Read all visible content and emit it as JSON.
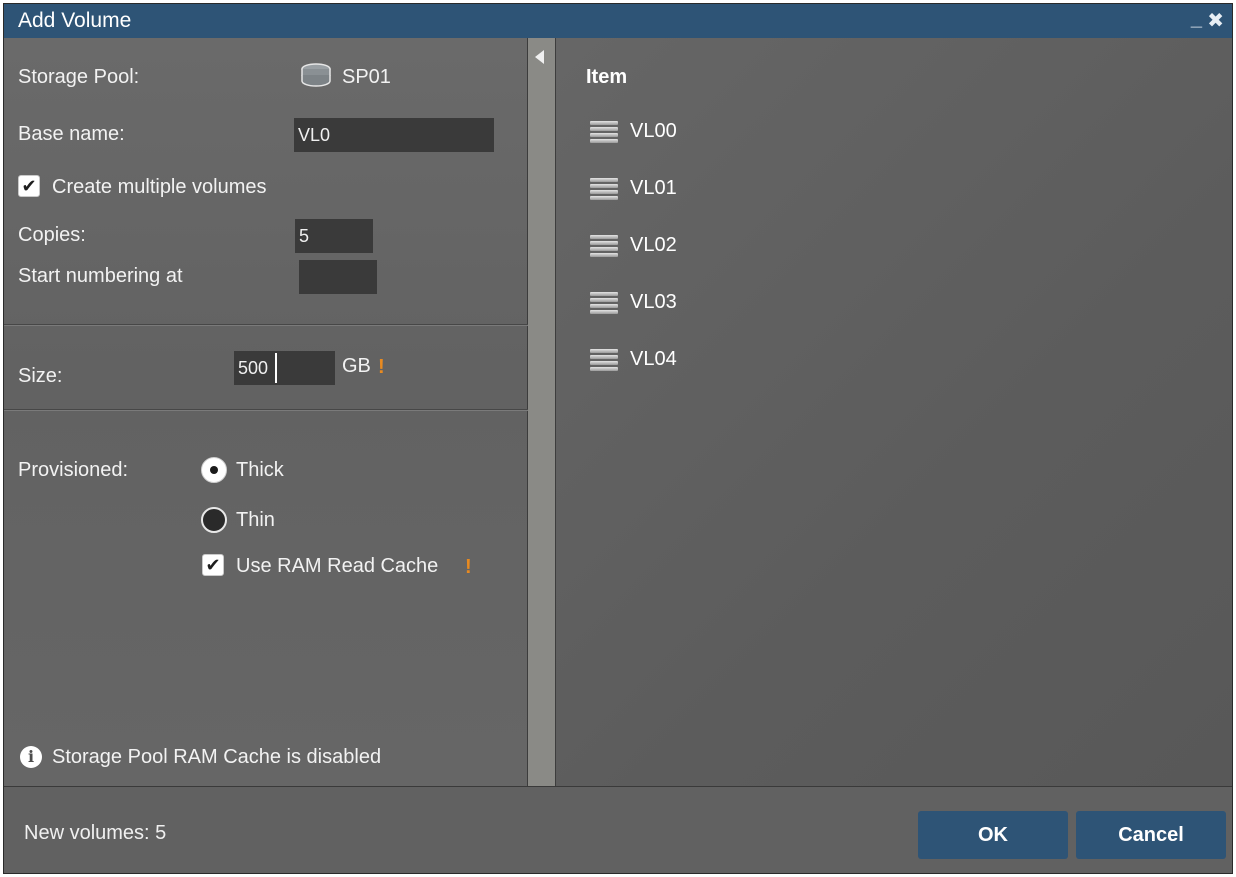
{
  "window": {
    "title": "Add Volume",
    "minimize_glyph": "_",
    "close_glyph": "✖"
  },
  "form": {
    "storage_pool_label": "Storage Pool:",
    "storage_pool_value": "SP01",
    "storage_pool_icon": "database-icon",
    "base_name_label": "Base name:",
    "base_name_value": "VL0",
    "create_multiple_label": "Create multiple volumes",
    "create_multiple_checked": true,
    "copies_label": "Copies:",
    "copies_value": "5",
    "start_numbering_label": "Start numbering at",
    "start_numbering_value": "",
    "size_label": "Size:",
    "size_value": "500",
    "size_unit": "GB",
    "warning_glyph": "!",
    "provisioned_label": "Provisioned:",
    "provision_options": [
      {
        "label": "Thick",
        "selected": true
      },
      {
        "label": "Thin",
        "selected": false
      }
    ],
    "ram_cache_label": "Use RAM Read Cache",
    "ram_cache_checked": true,
    "info_glyph": "i",
    "info_text": "Storage Pool RAM Cache is disabled"
  },
  "preview": {
    "column_header": "Item",
    "item_icon": "volume-icon",
    "items": [
      "VL00",
      "VL01",
      "VL02",
      "VL03",
      "VL04"
    ]
  },
  "footer": {
    "status": "New volumes: 5",
    "ok_label": "OK",
    "cancel_label": "Cancel"
  },
  "colors": {
    "titlebar": "#2e5476",
    "button": "#2e5476",
    "warning": "#e88a20",
    "panel": "#5f5f5f"
  }
}
